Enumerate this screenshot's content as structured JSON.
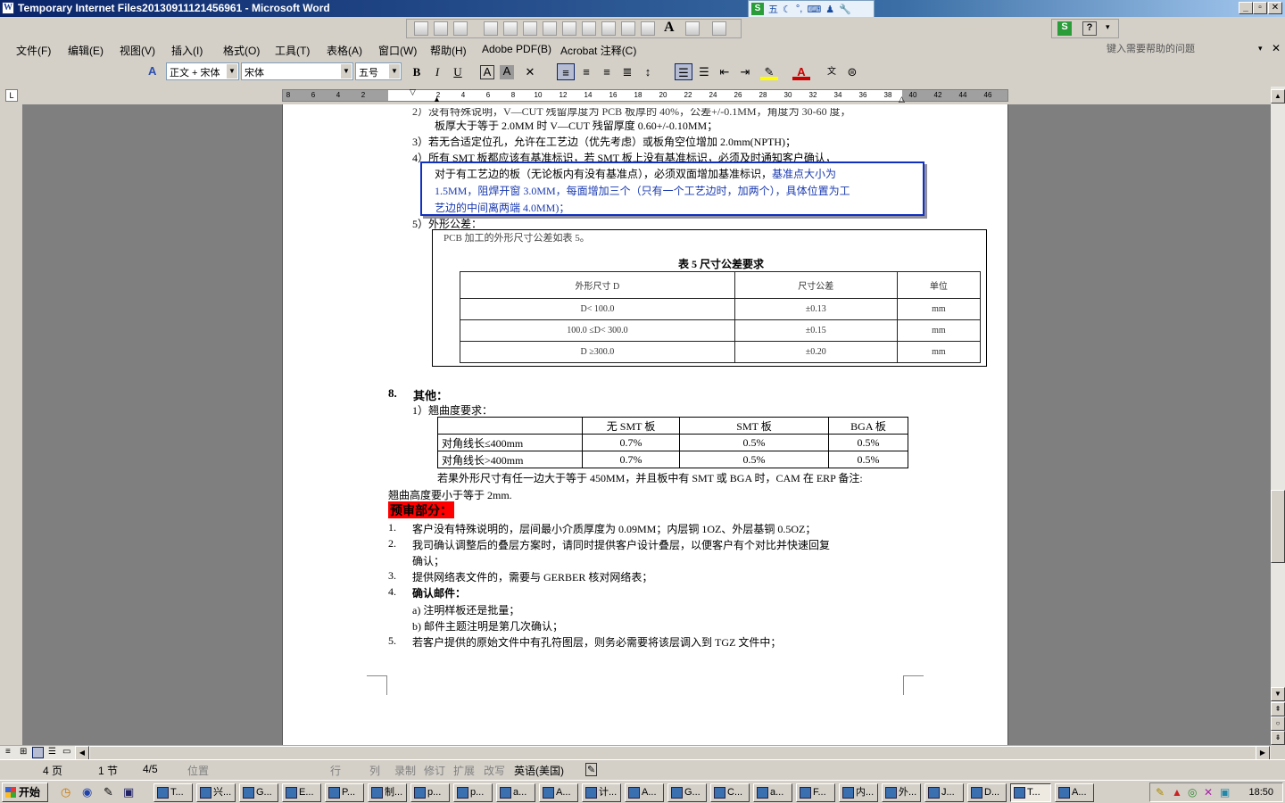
{
  "window": {
    "title": "Temporary Internet Files20130911121456961 - Microsoft Word"
  },
  "ime": {
    "label": "五"
  },
  "menu": [
    "文件(F)",
    "编辑(E)",
    "视图(V)",
    "插入(I)",
    "格式(O)",
    "工具(T)",
    "表格(A)",
    "窗口(W)",
    "帮助(H)",
    "Adobe PDF(B)",
    "Acrobat 注释(C)"
  ],
  "help_box": {
    "placeholder": "键入需要帮助的问题"
  },
  "format_bar": {
    "style": "正文 + 宋体",
    "font": "宋体",
    "size": "五号",
    "bold": "B",
    "italic": "I",
    "underline": "U"
  },
  "ruler": {
    "numbers": [
      "8",
      "6",
      "4",
      "2",
      "",
      "2",
      "4",
      "6",
      "8",
      "10",
      "12",
      "14",
      "16",
      "18",
      "20",
      "22",
      "24",
      "26",
      "28",
      "30",
      "32",
      "34",
      "36",
      "38",
      "40",
      "42",
      "44",
      "46",
      "48"
    ]
  },
  "document": {
    "lines": [
      "2）没有特殊说明，V—CUT 残留厚度为 PCB 板厚的 40%，公差+/-0.1MM，角度为 30-60 度，",
      "板厚大于等于 2.0MM 时 V—CUT 残留厚度 0.60+/-0.10MM；",
      "3）若无合适定位孔，允许在工艺边（优先考虑）或板角空位增加 2.0mm(NPTH)；",
      "4）所有 SMT 板都应该有基准标识，若 SMT 板上没有基准标识，必须及时通知客户确认，"
    ],
    "highlight_lines": [
      [
        "对于有工艺边的板（无论板内有没有基准点），必须双面增加基准标识，",
        "基准点大小为"
      ],
      [
        "1.5MM，阻焊开窗 3.0MM，每面增加三个（只有一个工艺边时，加两个），具体位置为工",
        ""
      ],
      [
        "艺边的中间离两端 4.0MM)；",
        ""
      ]
    ],
    "item5": "5）外形公差：",
    "table5": {
      "intro": "PCB 加工的外形尺寸公差如表 5。",
      "caption": "表 5    尺寸公差要求",
      "headers": [
        "外形尺寸 D",
        "尺寸公差",
        "单位"
      ],
      "rows": [
        [
          "D< 100.0",
          "±0.13",
          "mm"
        ],
        [
          "100.0 ≤D< 300.0",
          "±0.15",
          "mm"
        ],
        [
          "D ≥300.0",
          "±0.20",
          "mm"
        ]
      ]
    },
    "section8": {
      "num": "8.",
      "title": "其他："
    },
    "warp_title": "1）翘曲度要求：",
    "warp_table": {
      "headers": [
        "",
        "无 SMT 板",
        "SMT 板",
        "BGA 板"
      ],
      "rows": [
        [
          "对角线长≤400mm",
          "0.7%",
          "0.5%",
          "0.5%"
        ],
        [
          "对角线长>400mm",
          "0.7%",
          "0.5%",
          "0.5%"
        ]
      ]
    },
    "warp_note_1": "若果外形尺寸有任一边大于等于 450MM，并且板中有 SMT 或 BGA 时，CAM 在 ERP 备注:",
    "warp_note_2": "翘曲高度要小于等于 2mm.",
    "pre_review": "预审部分：",
    "pre_items": [
      {
        "n": "1.",
        "t": "客户没有特殊说明的，层间最小介质厚度为 0.09MM；内层铜 1OZ、外层基铜 0.5OZ；"
      },
      {
        "n": "2.",
        "t": "我司确认调整后的叠层方案时，请同时提供客户设计叠层，以便客户有个对比并快速回复"
      },
      {
        "n": "",
        "t": "确认；"
      },
      {
        "n": "3.",
        "t": "提供网络表文件的，需要与 GERBER 核对网络表；"
      },
      {
        "n": "4.",
        "t": "确认邮件：",
        "bold": true
      },
      {
        "n": "",
        "t": "a)   注明样板还是批量；"
      },
      {
        "n": "",
        "t": "b)   邮件主题注明是第几次确认；"
      },
      {
        "n": "5.",
        "t": "若客户提供的原始文件中有孔符图层，则务必需要将该层调入到 TGZ 文件中；"
      }
    ]
  },
  "status": {
    "page": "4 页",
    "section": "1 节",
    "pages": "4/5",
    "position": "位置",
    "row": "行",
    "col": "列",
    "rec": "录制",
    "trk": "修订",
    "ext": "扩展",
    "ovr": "改写",
    "lang": "英语(美国)"
  },
  "taskbar": {
    "start": "开始",
    "tasks": [
      "T...",
      "兴...",
      "G...",
      "E...",
      "P...",
      "制...",
      "p...",
      "p...",
      "a...",
      "A...",
      "计...",
      "A...",
      "G...",
      "C...",
      "a...",
      "F...",
      "内...",
      "外...",
      "J...",
      "D...",
      "T...",
      "A..."
    ],
    "active_index": 20,
    "clock": "18:50"
  },
  "colors": {
    "titlebar": "#0a246a",
    "highlight_box": "#1030c0",
    "pre_review_bg": "#ff0000"
  }
}
